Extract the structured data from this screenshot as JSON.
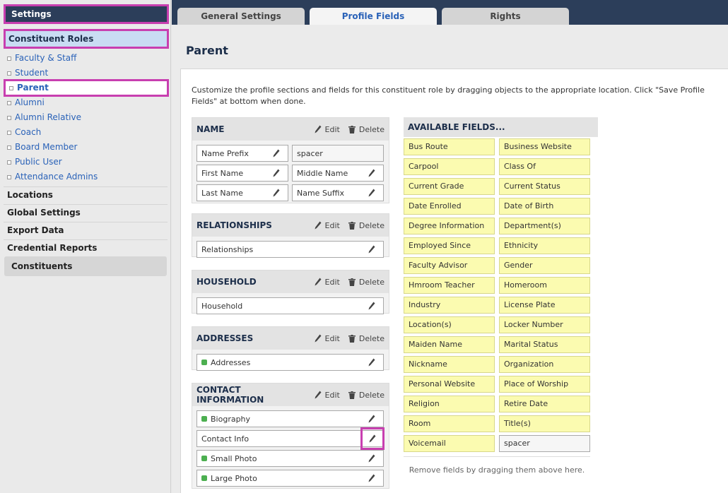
{
  "sidebar": {
    "title": "Settings",
    "roles_header": "Constituent Roles",
    "roles": [
      "Faculty & Staff",
      "Student",
      "Parent",
      "Alumni",
      "Alumni Relative",
      "Coach",
      "Board Member",
      "Public User",
      "Attendance Admins"
    ],
    "active_role": "Parent",
    "links": [
      "Locations",
      "Global Settings",
      "Export Data",
      "Credential Reports"
    ],
    "constituents": "Constituents"
  },
  "tabs": [
    "General Settings",
    "Profile Fields",
    "Rights"
  ],
  "active_tab": "Profile Fields",
  "page_title": "Parent",
  "description": "Customize the profile sections and fields for this constituent role by dragging objects to the appropriate location. Click \"Save Profile Fields\" at bottom when done.",
  "actions": {
    "edit": "Edit",
    "delete": "Delete"
  },
  "sections": [
    {
      "title": "NAME",
      "rows": [
        [
          {
            "label": "Name Prefix",
            "edit": true
          },
          {
            "label": "spacer",
            "spacer": true
          }
        ],
        [
          {
            "label": "First Name",
            "edit": true
          },
          {
            "label": "Middle Name",
            "edit": true
          }
        ],
        [
          {
            "label": "Last Name",
            "edit": true
          },
          {
            "label": "Name Suffix",
            "edit": true
          }
        ]
      ]
    },
    {
      "title": "RELATIONSHIPS",
      "rows": [
        [
          {
            "label": "Relationships",
            "edit": true,
            "wide": true
          }
        ]
      ]
    },
    {
      "title": "HOUSEHOLD",
      "rows": [
        [
          {
            "label": "Household",
            "edit": true,
            "wide": true
          }
        ]
      ]
    },
    {
      "title": "ADDRESSES",
      "rows": [
        [
          {
            "label": "Addresses",
            "edit": true,
            "wide": true,
            "dot": true
          }
        ]
      ]
    },
    {
      "title": "CONTACT INFORMATION",
      "rows": [
        [
          {
            "label": "Biography",
            "edit": true,
            "wide": true,
            "dot": true
          }
        ],
        [
          {
            "label": "Contact Info",
            "edit": true,
            "wide": true,
            "highlight": true
          }
        ],
        [
          {
            "label": "Small Photo",
            "edit": true,
            "wide": true,
            "dot": true
          }
        ],
        [
          {
            "label": "Large Photo",
            "edit": true,
            "wide": true,
            "dot": true
          }
        ]
      ]
    }
  ],
  "available": {
    "title": "AVAILABLE FIELDS...",
    "fields": [
      "Bus Route",
      "Business Website",
      "Carpool",
      "Class Of",
      "Current Grade",
      "Current Status",
      "Date Enrolled",
      "Date of Birth",
      "Degree Information",
      "Department(s)",
      "Employed Since",
      "Ethnicity",
      "Faculty Advisor",
      "Gender",
      "Hmroom Teacher",
      "Homeroom",
      "Industry",
      "License Plate",
      "Location(s)",
      "Locker Number",
      "Maiden Name",
      "Marital Status",
      "Nickname",
      "Organization",
      "Personal Website",
      "Place of Worship",
      "Religion",
      "Retire Date",
      "Room",
      "Title(s)",
      "Voicemail",
      "spacer"
    ],
    "footer": "Remove fields by dragging them above here."
  },
  "colors": {
    "accent": "#2c3e5a",
    "link": "#2a62b8",
    "highlight": "#c83fb0",
    "field_yellow": "#fbfbb0"
  }
}
